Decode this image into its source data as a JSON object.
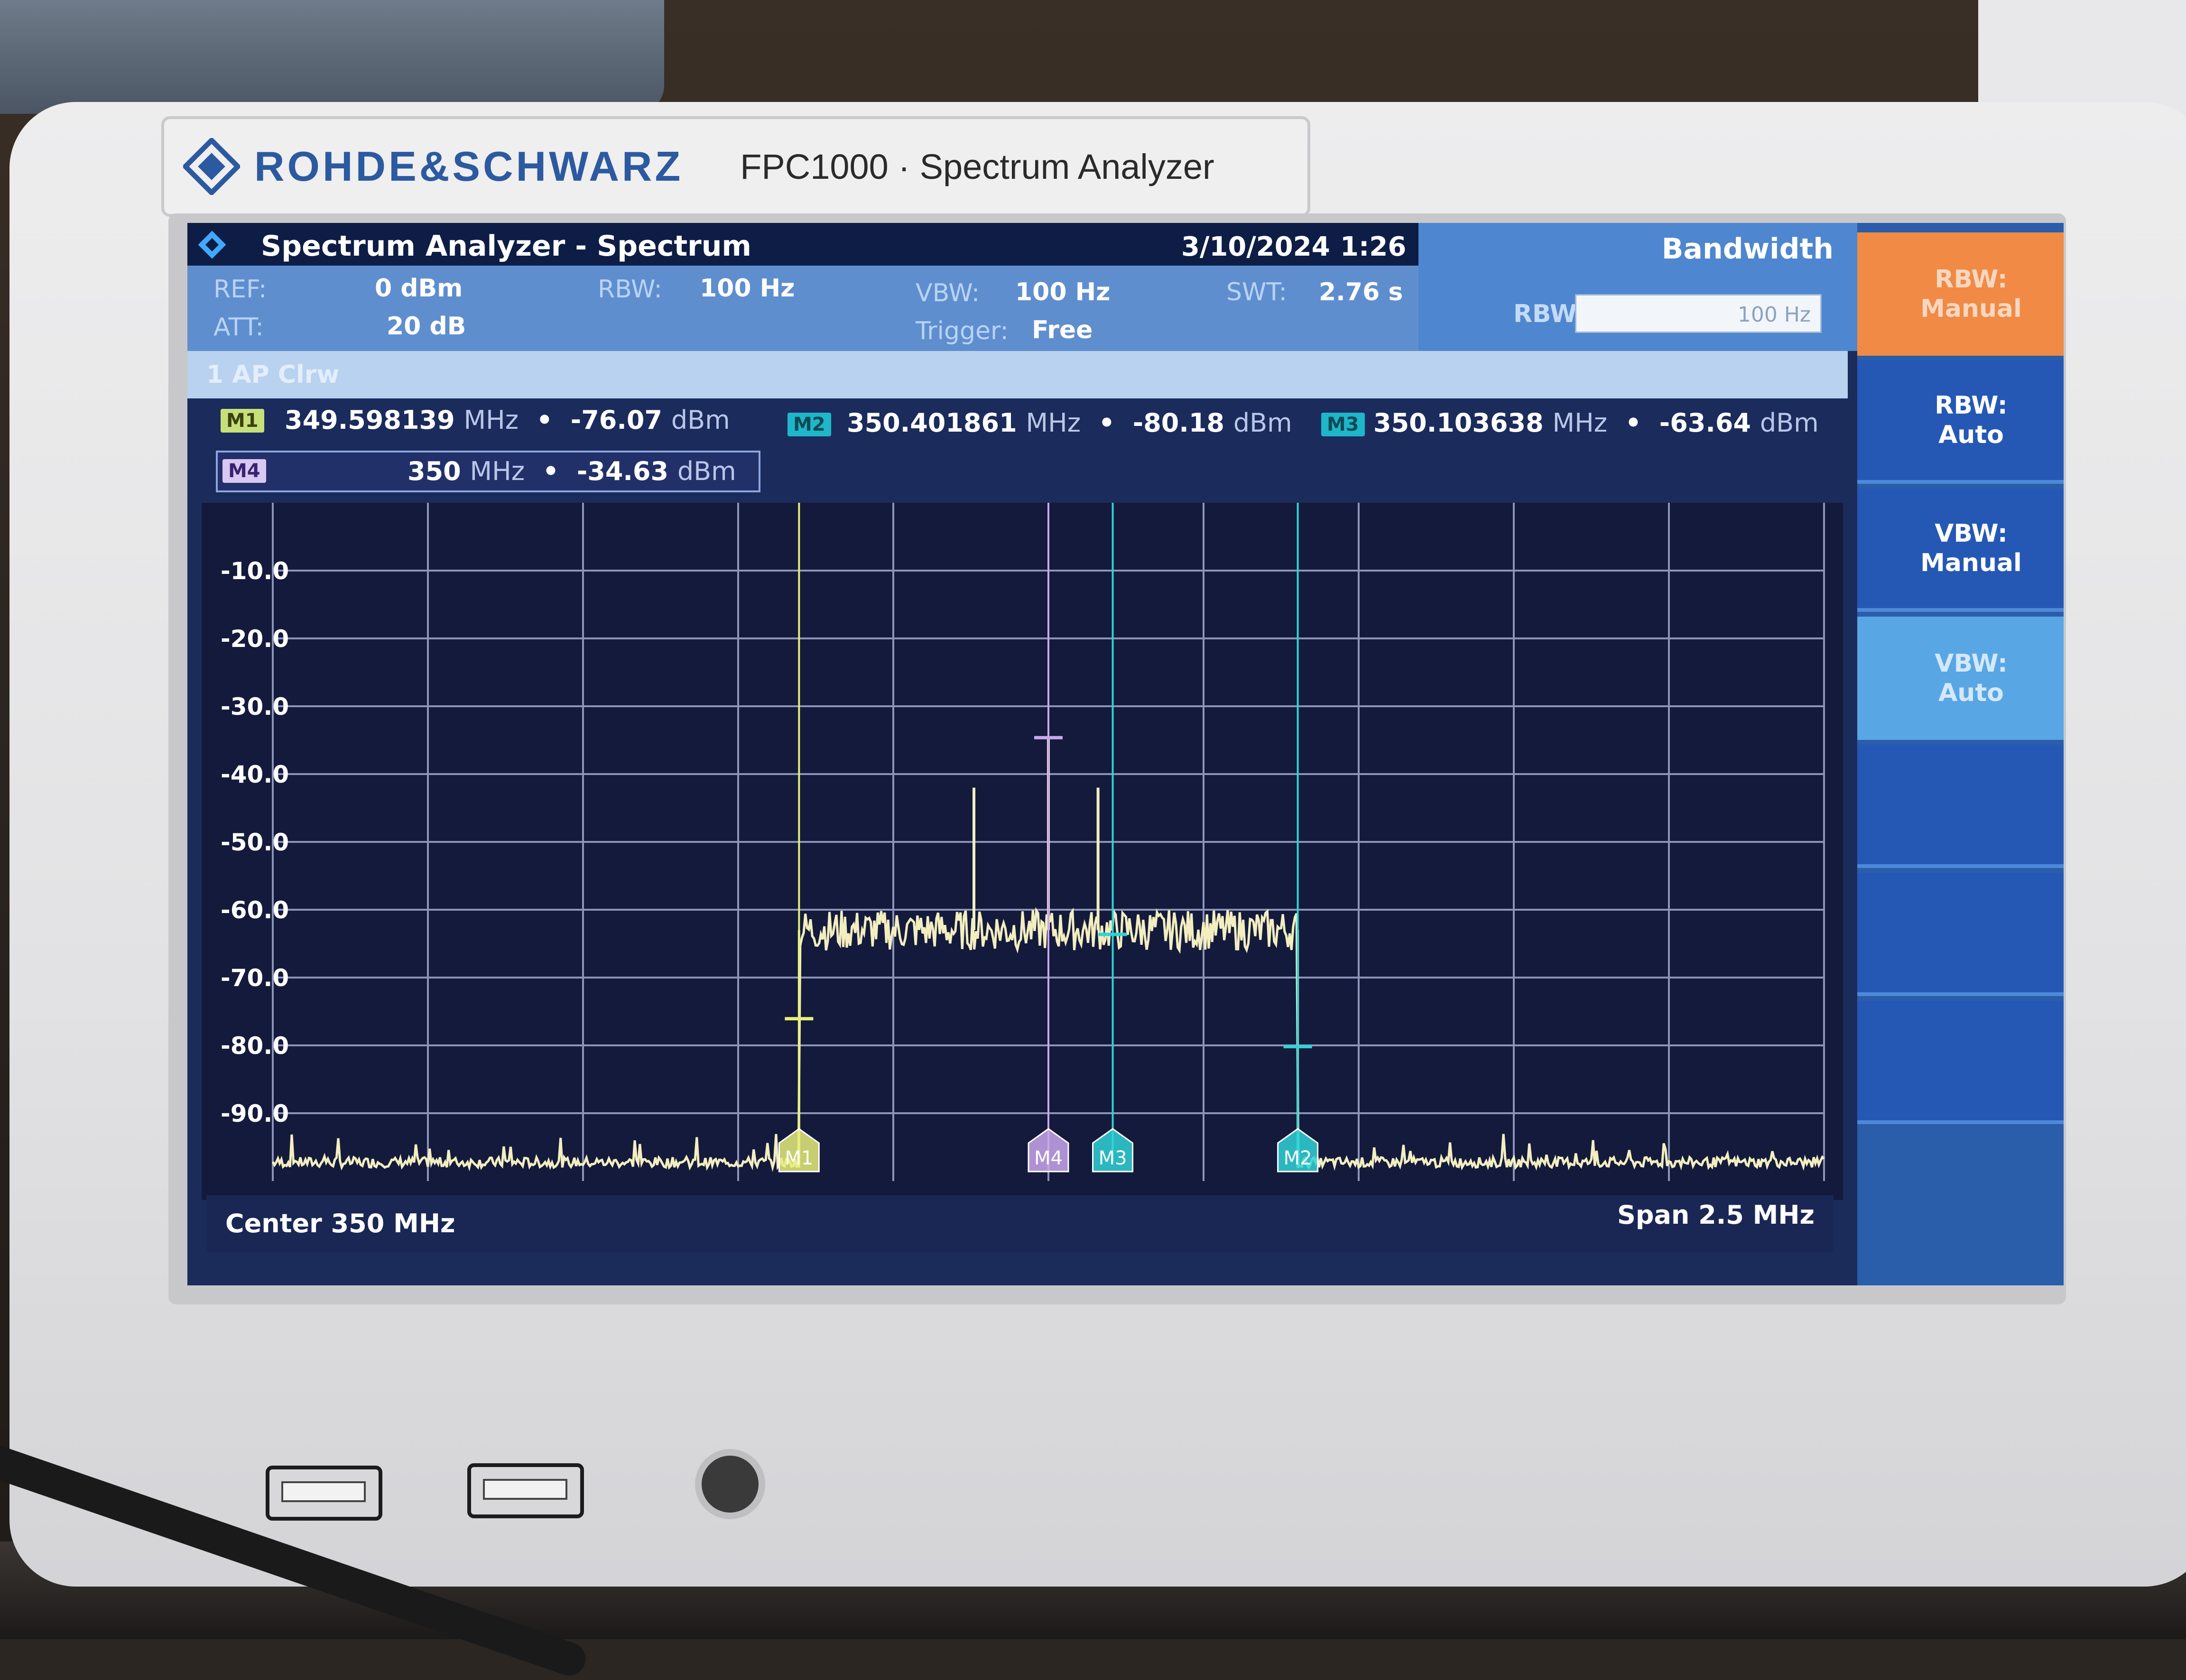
{
  "device": {
    "brand": "ROHDE&SCHWARZ",
    "model": "FPC1000 · Spectrum Analyzer"
  },
  "titlebar": {
    "title": "Spectrum Analyzer - Spectrum",
    "date": "3/10/2024",
    "time": "1:26"
  },
  "params": {
    "ref_label": "REF:",
    "ref_value": "0 dBm",
    "att_label": "ATT:",
    "att_value": "20 dB",
    "rbw_label": "RBW:",
    "rbw_value": "100 Hz",
    "vbw_label": "VBW:",
    "vbw_value": "100 Hz",
    "trigger_label": "Trigger:",
    "trigger_value": "Free",
    "swt_label": "SWT:",
    "swt_value": "2.76 s"
  },
  "trace": {
    "label": "1 AP Clrw"
  },
  "marker_table": {
    "m1": {
      "badge": "M1",
      "freq": "349.598139",
      "freq_unit": "MHz",
      "level": "-76.07",
      "level_unit": "dBm"
    },
    "m2": {
      "badge": "M2",
      "freq": "350.401861",
      "freq_unit": "MHz",
      "level": "-80.18",
      "level_unit": "dBm"
    },
    "m3": {
      "badge": "M3",
      "freq": "350.103638",
      "freq_unit": "MHz",
      "level": "-63.64",
      "level_unit": "dBm"
    },
    "m4": {
      "badge": "M4",
      "freq": "350",
      "freq_unit": "MHz",
      "level": "-34.63",
      "level_unit": "dBm"
    },
    "dot": "•"
  },
  "bandwidth_panel": {
    "title": "Bandwidth",
    "rbw_label": "RBW",
    "rbw_field": "100 Hz"
  },
  "softkeys": [
    {
      "label": "RBW:\nManual",
      "state": "active"
    },
    {
      "label": "RBW:\nAuto",
      "state": "normal"
    },
    {
      "label": "VBW:\nManual",
      "state": "normal"
    },
    {
      "label": "VBW:\nAuto",
      "state": "selected"
    }
  ],
  "footer": {
    "center": "Center 350 MHz",
    "span": "Span 2.5 MHz"
  },
  "colors": {
    "trace": "#f3eec0",
    "m1": "#e6ef7a",
    "m2": "#2fd3d6",
    "m3": "#2fd3d6",
    "m4": "#c9a7ec",
    "grid": "#8c95b8",
    "softkey_active": "#f08a45"
  },
  "chart_data": {
    "type": "line",
    "x_unit": "MHz",
    "y_unit": "dBm",
    "xlim": [
      348.75,
      351.25
    ],
    "ylim": [
      -100,
      0
    ],
    "y_tick_labels": [
      "-10.0",
      "-20.0",
      "-30.0",
      "-40.0",
      "-50.0",
      "-60.0",
      "-70.0",
      "-80.0",
      "-90.0"
    ],
    "y_ticks": [
      -10,
      -20,
      -30,
      -40,
      -50,
      -60,
      -70,
      -80,
      -90
    ],
    "grid": true,
    "noise_floor_dbm": -98,
    "band_edges_mhz": [
      349.598139,
      350.401861
    ],
    "band_level_dbm": -63,
    "spurs": [
      {
        "x": 349.88,
        "y": -42
      },
      {
        "x": 350.0,
        "y": -34.63
      },
      {
        "x": 350.08,
        "y": -42
      }
    ],
    "markers": [
      {
        "name": "M1",
        "x": 349.598139,
        "y": -76.07
      },
      {
        "name": "M2",
        "x": 350.401861,
        "y": -80.18
      },
      {
        "name": "M3",
        "x": 350.103638,
        "y": -63.64
      },
      {
        "name": "M4",
        "x": 350.0,
        "y": -34.63
      }
    ]
  }
}
